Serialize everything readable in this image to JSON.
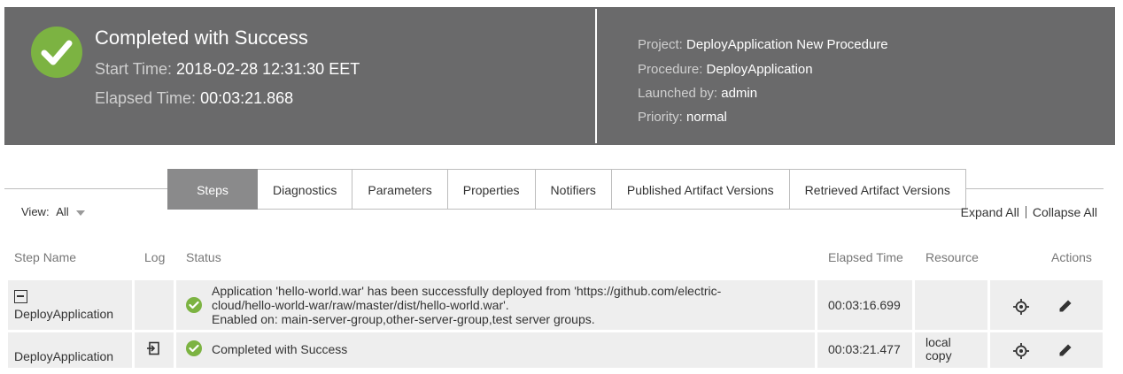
{
  "header": {
    "title": "Completed with Success",
    "start_time_label": "Start Time:",
    "start_time": "2018-02-28 12:31:30 EET",
    "elapsed_label": "Elapsed Time:",
    "elapsed": "00:03:21.868",
    "project_label": "Project:",
    "project": "DeployApplication New Procedure",
    "procedure_label": "Procedure:",
    "procedure": "DeployApplication",
    "launched_label": "Launched by:",
    "launched": "admin",
    "priority_label": "Priority:",
    "priority": "normal",
    "status_color": "#7cb342"
  },
  "tabs": [
    {
      "label": "Steps",
      "active": true
    },
    {
      "label": "Diagnostics"
    },
    {
      "label": "Parameters"
    },
    {
      "label": "Properties"
    },
    {
      "label": "Notifiers"
    },
    {
      "label": "Published Artifact Versions"
    },
    {
      "label": "Retrieved Artifact Versions"
    }
  ],
  "view": {
    "label": "View:",
    "value": "All"
  },
  "expand_all": "Expand All",
  "collapse_all": "Collapse All",
  "columns": {
    "step_name": "Step Name",
    "log": "Log",
    "status": "Status",
    "elapsed": "Elapsed Time",
    "resource": "Resource",
    "actions": "Actions"
  },
  "rows": [
    {
      "step_name": "DeployApplication",
      "status_line1": "Application 'hello-world.war' has been successfully deployed from 'https://github.com/electric-",
      "status_line2": "cloud/hello-world-war/raw/master/dist/hello-world.war'.",
      "status_line3": "Enabled on: main-server-group,other-server-group,test server groups.",
      "elapsed": "00:03:16.699",
      "resource": ""
    },
    {
      "step_name": "DeployApplication",
      "status_line1": "Completed with Success",
      "elapsed": "00:03:21.477",
      "resource": "local copy"
    }
  ]
}
